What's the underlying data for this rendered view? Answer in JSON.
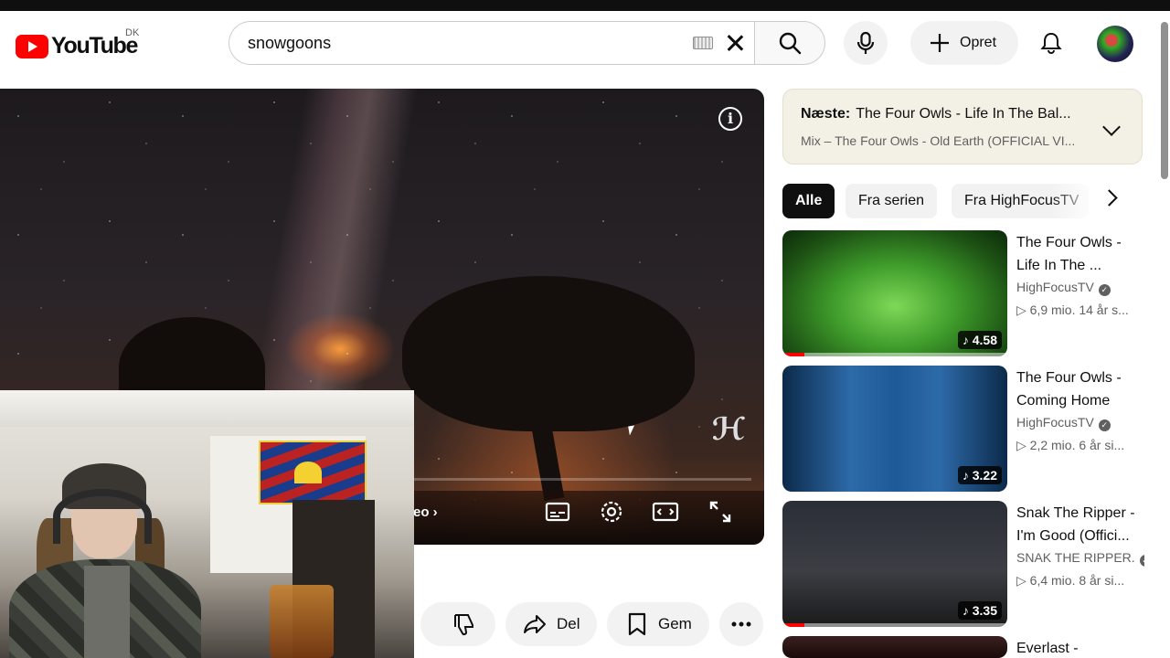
{
  "header": {
    "logo_text": "YouTube",
    "country_code": "DK",
    "search_value": "snowgoons",
    "create_label": "Opret"
  },
  "player": {
    "next_video_text": "eo"
  },
  "actions": {
    "share_label": "Del",
    "save_label": "Gem"
  },
  "up_next": {
    "prefix": "Næste:",
    "title": "The Four Owls - Life In The Bal...",
    "subtitle": "Mix – The Four Owls - Old Earth (OFFICIAL VI..."
  },
  "chips": [
    "Alle",
    "Fra serien",
    "Fra HighFocusTV"
  ],
  "recommendations": [
    {
      "title": "The Four Owls - Life In The ...",
      "channel": "HighFocusTV",
      "verified": true,
      "meta": "6,9 mio.  14 år s...",
      "duration": "4.58",
      "watched_fraction": 0.1
    },
    {
      "title": "The Four Owls - Coming Home",
      "channel": "HighFocusTV",
      "verified": true,
      "meta": "2,2 mio.  6 år si...",
      "duration": "3.22",
      "watched_fraction": 0
    },
    {
      "title": "Snak The Ripper - I'm Good (Offici...",
      "channel": "SNAK THE RIPPER.",
      "verified": true,
      "meta": "6,4 mio.  8 år si...",
      "duration": "3.35",
      "watched_fraction": 0.1
    },
    {
      "title": "Everlast -",
      "channel": "",
      "verified": false,
      "meta": "",
      "duration": "",
      "watched_fraction": 0
    }
  ],
  "colors": {
    "brand_red": "#ff0000",
    "up_next_bg": "#f3f1e6",
    "chip_active": "#0f0f0f"
  }
}
